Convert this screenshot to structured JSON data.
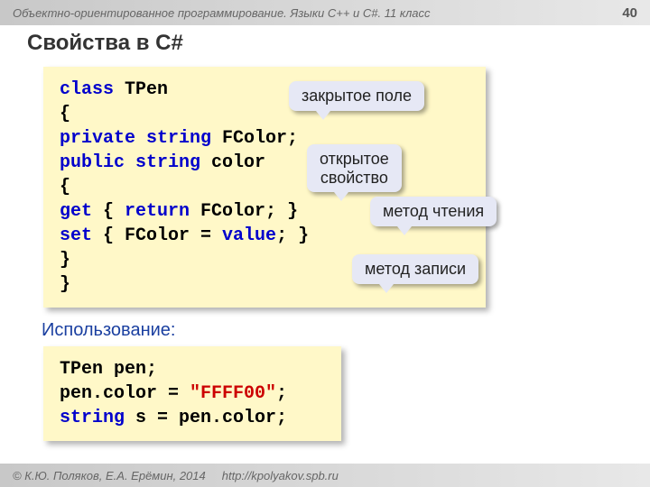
{
  "header": {
    "breadcrumb": "Объектно-ориентированное программирование. Языки C++ и C#. 11 класс",
    "page": "40"
  },
  "title": "Свойства в C#",
  "code_main": {
    "l1": {
      "kw": "class",
      "id": " TPen"
    },
    "l2": "{",
    "l3": {
      "indent": "  ",
      "kw1": "private",
      "sp1": " ",
      "kw2": "string",
      "id": " FColor;"
    },
    "l4": {
      "indent": "  ",
      "kw1": "public",
      "sp1": " ",
      "kw2": "string",
      "id": " color"
    },
    "l5": "  {",
    "l6": {
      "indent": "    ",
      "kw1": "get",
      "mid": " { ",
      "kw2": "return",
      "rest": " FColor; }"
    },
    "l7": {
      "indent": "    ",
      "kw1": "set",
      "mid": " { FColor = ",
      "kw2": "value",
      "rest": "; }"
    },
    "l8": "  }",
    "l9": "}"
  },
  "callouts": {
    "private_field": "закрытое поле",
    "public_property_l1": "открытое",
    "public_property_l2": "свойство",
    "getter": "метод чтения",
    "setter": "метод записи"
  },
  "usage_label": "Использование:",
  "code_usage": {
    "l1": "TPen pen;",
    "l2a": "pen.color = ",
    "l2b": "\"FFFF00\"",
    "l2c": ";",
    "l3a": "string",
    "l3b": " s = pen.color;"
  },
  "footer": {
    "copyright": "© К.Ю. Поляков, Е.А. Ерёмин, 2014",
    "url": "http://kpolyakov.spb.ru"
  }
}
